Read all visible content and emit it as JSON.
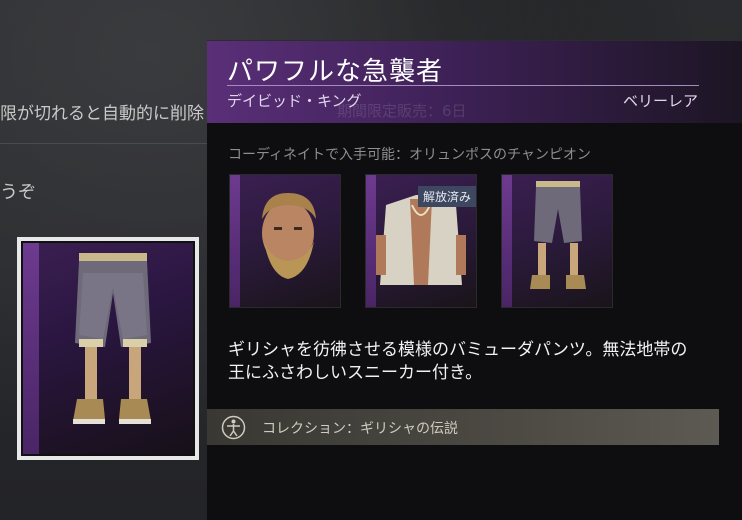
{
  "background": {
    "text_line_1": "限が切れると自動的に削除",
    "text_line_2": "うぞ"
  },
  "tooltip": {
    "title": "パワフルな急襲者",
    "owner": "デイビッド・キング",
    "rarity": "ベリーレア",
    "ghost_text": "期間限定販売：6日",
    "set_label": "コーディネイトで入手可能：オリュンポスのチャンピオン",
    "set_items": [
      {
        "name": "head",
        "icon": "bearded-head-icon",
        "unlocked": false
      },
      {
        "name": "torso",
        "icon": "open-jacket-torso-icon",
        "unlocked": true
      },
      {
        "name": "legs",
        "icon": "bermuda-pants-icon",
        "unlocked": false
      }
    ],
    "unlocked_label": "解放済み",
    "description": "ギリシャを彷彿させる模様のバミューダパンツ。無法地帯の王にふさわしいスニーカー付き。",
    "collection_text": "コレクション：ギリシャの伝説",
    "collection_icon": "vitruvian-man-icon"
  },
  "colors": {
    "header_purple": "#5a2f78",
    "rarity_frame": "#6d3a8f",
    "collection_bar": "#4c4a43",
    "unlocked_badge": "#3d4760"
  }
}
